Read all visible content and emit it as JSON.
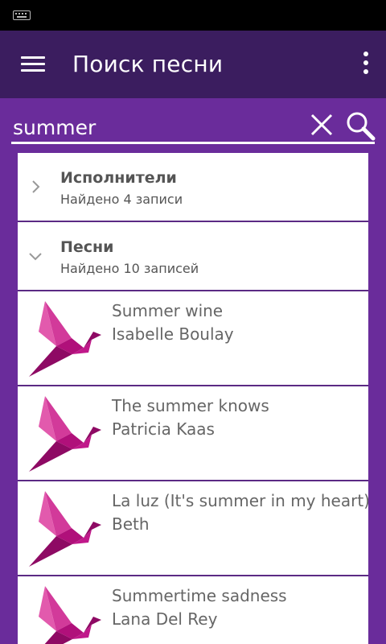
{
  "status_bar": {
    "icons": [
      "keyboard-icon"
    ]
  },
  "app_bar": {
    "title": "Поиск песни",
    "icons": [
      "hamburger-menu-icon",
      "overflow-menu-icon"
    ]
  },
  "search": {
    "query": "summer",
    "icons": [
      "close-icon",
      "search-icon"
    ]
  },
  "groups": [
    {
      "title": "Исполнители",
      "count": "Найдено 4 записи",
      "expanded": false
    },
    {
      "title": "Песни",
      "count": "Найдено 10 записей",
      "expanded": true
    }
  ],
  "songs": [
    {
      "title": "Summer wine",
      "artist": "Isabelle Boulay"
    },
    {
      "title": "The summer knows",
      "artist": "Patricia Kaas"
    },
    {
      "title": "La luz (It's summer in my heart)",
      "artist": "Beth"
    },
    {
      "title": "Summertime sadness",
      "artist": "Lana Del Rey"
    }
  ],
  "colors": {
    "background": "#6a2c9b",
    "app_bar": "#3b1d5f",
    "logo": "#b0107a",
    "divider": "#5b2a84"
  }
}
